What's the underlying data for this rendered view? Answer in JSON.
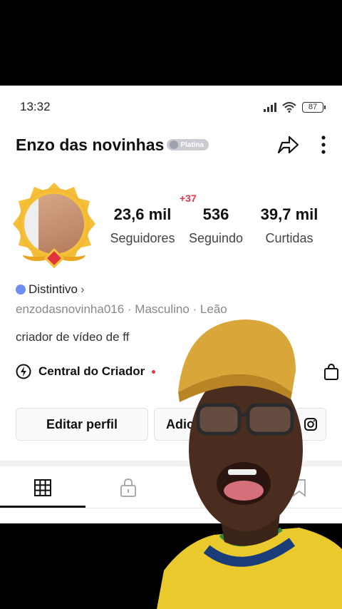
{
  "status": {
    "time": "13:32",
    "battery": "87"
  },
  "profile": {
    "username": "Enzo das novinhas",
    "tier": "Platina",
    "stats": [
      {
        "value": "23,6 mil",
        "label": "Seguidores"
      },
      {
        "value": "536",
        "label": "Seguindo"
      },
      {
        "value": "39,7 mil",
        "label": "Curtidas"
      }
    ],
    "new_followers": "+37",
    "badge_label": "Distintivo",
    "meta": "enzodasnovinha016 · Masculino · Leão",
    "bio": "criador de vídeo de ff",
    "creator_center": "Central do Criador"
  },
  "buttons": {
    "edit_profile": "Editar perfil",
    "add_friends": "Adic"
  },
  "colors": {
    "accent_red": "#e8334a",
    "gold": "#f4c43d",
    "shirt_yellow": "#e9c92c"
  },
  "icons": {
    "share": "share-arrow-icon",
    "more": "vertical-dots-icon",
    "grid_tab": "grid-icon",
    "lock_tab": "lock-icon",
    "bookmark_tab": "bookmark-icon",
    "instagram": "instagram-icon",
    "shop": "shopping-bag-icon",
    "creator": "lightning-icon"
  }
}
